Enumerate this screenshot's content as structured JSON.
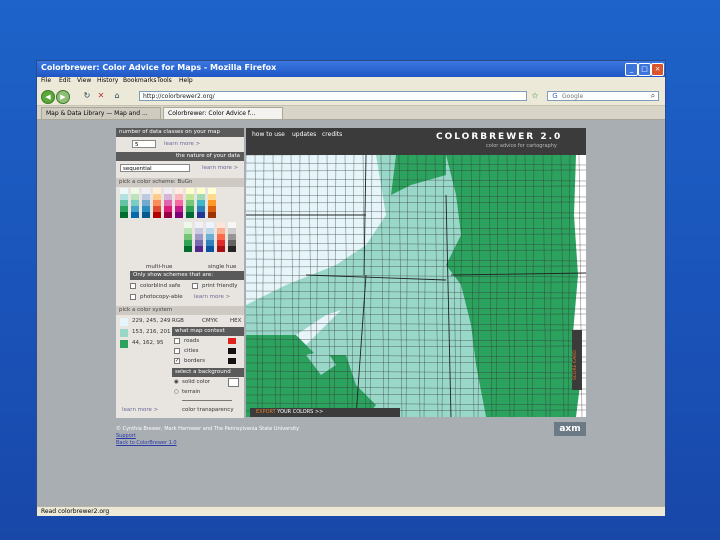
{
  "window": {
    "title": "Colorbrewer: Color Advice for Maps - Mozilla Firefox",
    "controls": [
      "_",
      "□",
      "×"
    ]
  },
  "menu": [
    "File",
    "Edit",
    "View",
    "History",
    "Bookmarks",
    "Tools",
    "Help"
  ],
  "nav": {
    "url": "http://colorbrewer2.org/",
    "search_placeholder": "Google"
  },
  "tabs": [
    {
      "label": "Map & Data Library — Map and ..."
    },
    {
      "label": "Colorbrewer: Color Advice f..."
    }
  ],
  "left_panel": {
    "classes_header": "number of data classes on your map",
    "classes_value": "5",
    "learn_more": "learn more >",
    "nature_header": "the nature of your data",
    "nature_value": "sequential",
    "nature_link": "learn more >",
    "scheme_header": "pick a color scheme: BuGn",
    "multihue": "multi-hue",
    "single_hue": "single hue",
    "only_show": "Only show schemes that are:",
    "opt_colorblind": "colorblind safe",
    "opt_print": "print friendly",
    "opt_photocopy": "photocopy-able",
    "learn_more2": "learn more >",
    "system_header": "pick a color system",
    "color_values": [
      "229, 245, 249",
      "153, 216, 201",
      "44, 162, 95"
    ],
    "color_colors": [
      "#e5f5f9",
      "#99d8c9",
      "#2ca25f"
    ],
    "systems": [
      "RGB",
      "CMYK",
      "HEX"
    ],
    "context_header": "what map context",
    "context_items": [
      "roads",
      "cities",
      "borders"
    ],
    "background_header": "select a background",
    "bg_items": [
      "solid color",
      "terrain"
    ],
    "color_transparency": "color transparency",
    "learn_more3": "learn more >"
  },
  "top_nav": {
    "how_to_use": "how to use",
    "updates": "updates",
    "credits": "credits",
    "brand": "COLORBREWER 2.0",
    "tagline": "color advice for cartography"
  },
  "map": {
    "export_label": "EXPORT",
    "export_text": "YOUR COLORS >>",
    "score_card": "SCORE CARD"
  },
  "footer": {
    "copyright": "© Cynthia Brewer, Mark Harrower and The Pennsylvania State University",
    "support": "Support",
    "back_link": "Back to ColorBrewer 1.0",
    "logo": "axm"
  },
  "status": "Read colorbrewer2.org"
}
